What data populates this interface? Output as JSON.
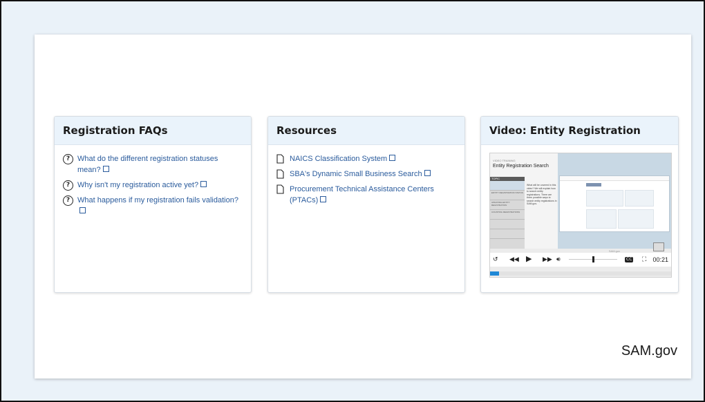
{
  "brand": "SAM.gov",
  "faqs": {
    "title": "Registration FAQs",
    "items": [
      "What do the different registration statuses mean?",
      "Why isn't my registration active yet?",
      "What happens if my registration fails validation?"
    ]
  },
  "resources": {
    "title": "Resources",
    "items": [
      "NAICS Classification System",
      "SBA's Dynamic Small Business Search",
      "Procurement Technical Assistance Centers (PTACs)"
    ]
  },
  "video": {
    "title": "Video: Entity Registration",
    "kicker": "VIDEO TRAINING",
    "slide_title": "Entity Registration Search",
    "topics_header": "TOPIC",
    "topics": [
      "",
      "ENTITY REGISTRATION STATUS",
      "UPDATING ENTITY REGISTRATION",
      "COUNTING REGISTRATIONS"
    ],
    "description": "What will be covered in this video? We will explain how to search entity registrations. There are three possible ways to search entity registrations in SAM.gov.",
    "caption": "SAM.gov",
    "time": "00:21",
    "progress_fraction": 0.05,
    "volume_fraction": 0.48
  },
  "icons": {
    "question": "question-circle-icon",
    "document": "document-icon",
    "external": "external-link-icon",
    "replay": "replay-icon",
    "rewind": "rewind-icon",
    "play": "play-icon",
    "forward": "fast-forward-icon",
    "volume": "volume-icon",
    "cc": "closed-captions-icon",
    "fullscreen": "fullscreen-icon"
  },
  "colors": {
    "link": "#2a5b9c",
    "header_bg": "#eaf3fb",
    "progress": "#1f88d6"
  }
}
